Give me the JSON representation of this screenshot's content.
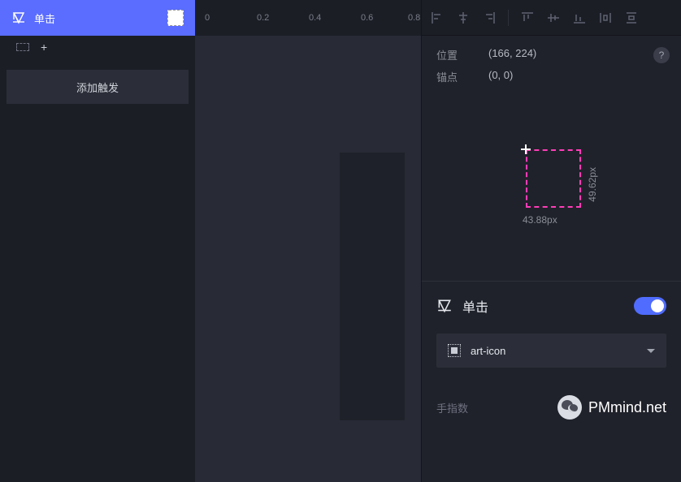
{
  "left": {
    "trigger_label": "单击",
    "add_trigger_label": "添加触发",
    "plus": "+"
  },
  "ruler": {
    "t0": "0",
    "t1": "0.2",
    "t2": "0.4",
    "t3": "0.6",
    "t4": "0.8"
  },
  "props": {
    "position_label": "位置",
    "position_value": "(166, 224)",
    "anchor_label": "锚点",
    "anchor_value": "(0, 0)",
    "help": "?",
    "width_dim": "43.88px",
    "height_dim": "49.62px"
  },
  "event": {
    "label": "单击",
    "dropdown_value": "art-icon",
    "fingers_label": "手指数"
  },
  "brand": "PMmind.net"
}
